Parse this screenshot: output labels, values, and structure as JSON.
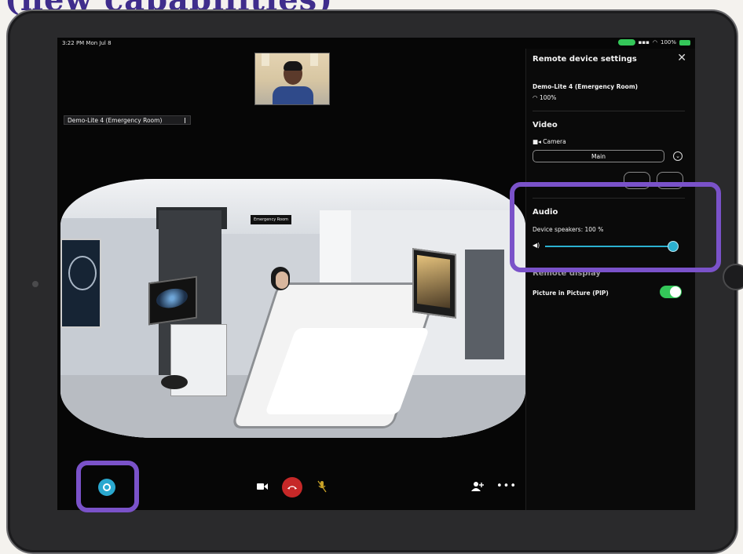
{
  "banner": {
    "text": "(new capabilities)"
  },
  "status_bar": {
    "time": "3:22 PM  Mon Jul 8",
    "battery": "100%"
  },
  "video": {
    "room_label": "Demo-Lite 4 (Emergency Room)",
    "room_sign": "Emergency Room"
  },
  "toolbar": {
    "chat_icon": "chat-icon",
    "camera_icon": "video-camera-icon",
    "hangup_icon": "hang-up-icon",
    "mute_icon": "microphone-muted-icon",
    "add_user_icon": "add-participant-icon",
    "more_icon": "more-options-icon"
  },
  "panel": {
    "title": "Remote device settings",
    "close": "✕",
    "device_name": "Demo-Lite 4 (Emergency Room)",
    "wifi": "100%",
    "video_heading": "Video",
    "camera_label": "Camera",
    "camera_select_value": "Main",
    "audio_heading": "Audio",
    "speakers_label": "Device speakers:",
    "speakers_value": "100 %",
    "speakers_level": 0.95,
    "remote_display_heading": "Remote display",
    "pip_label": "Picture in Picture (PIP)",
    "pip_enabled": true
  },
  "colors": {
    "accent_cyan": "#2bb0d0",
    "toggle_green": "#34c759",
    "highlight_purple": "#7a52c9",
    "hangup_red": "#c62828"
  }
}
